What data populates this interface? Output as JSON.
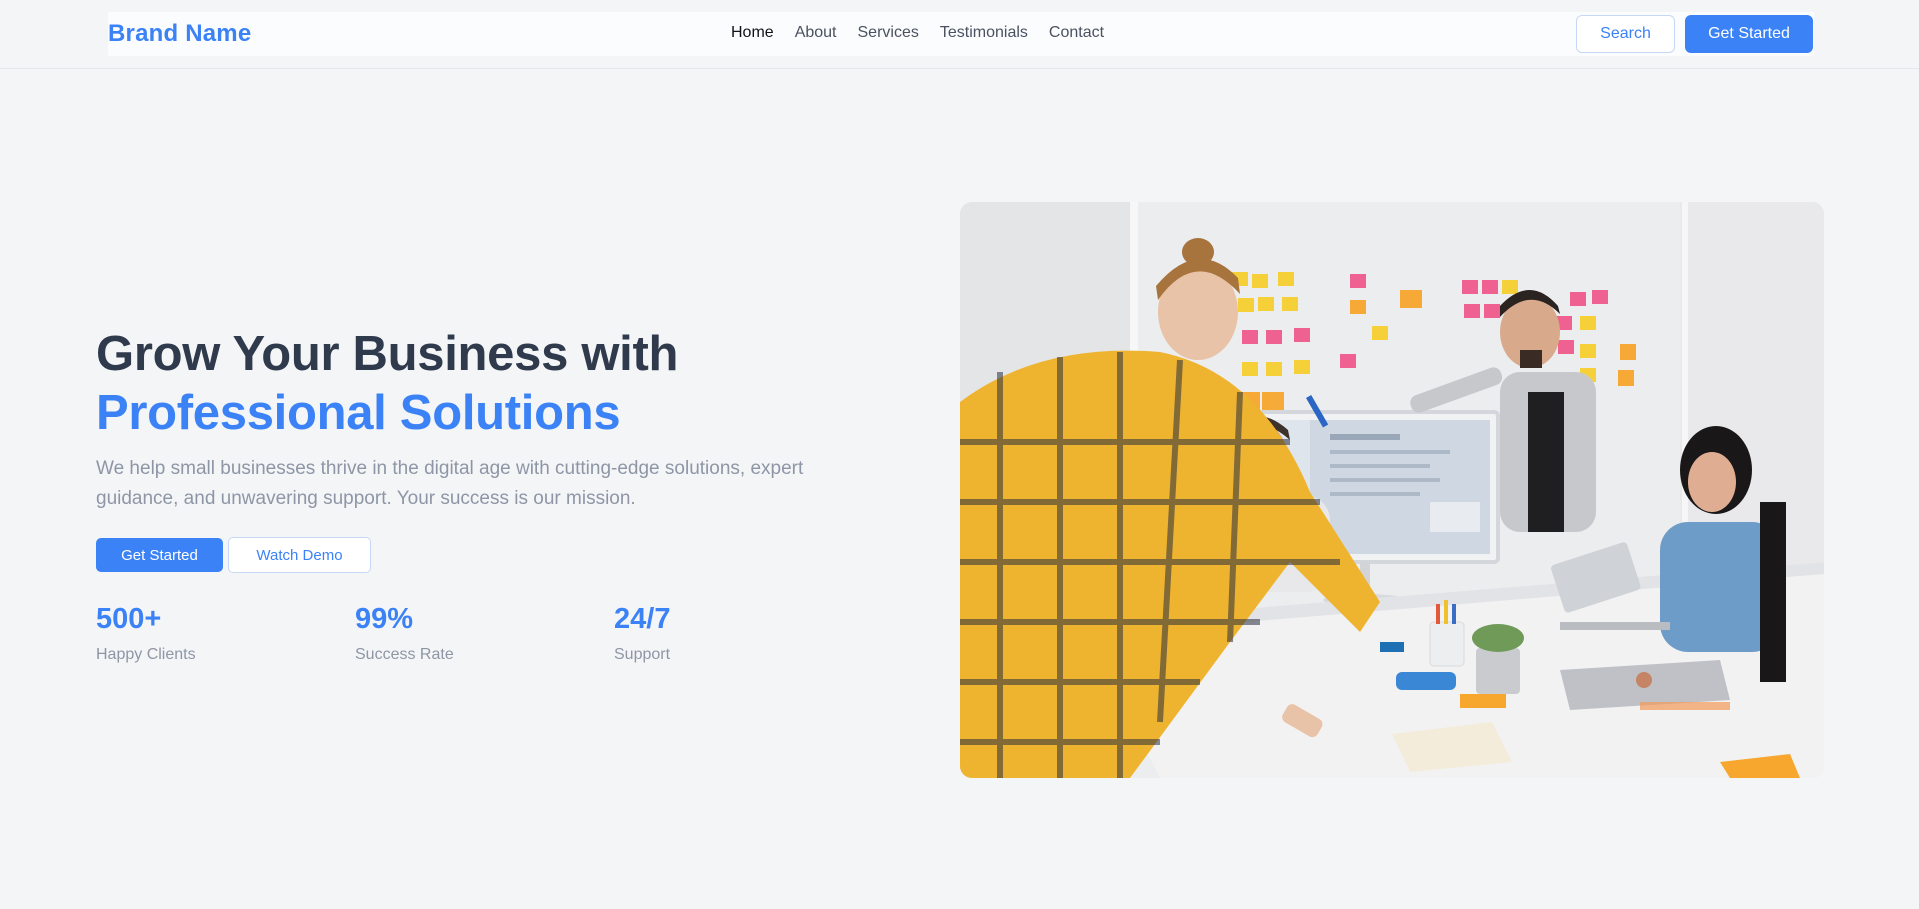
{
  "header": {
    "brand": "Brand Name",
    "nav": [
      {
        "label": "Home",
        "active": true
      },
      {
        "label": "About",
        "active": false
      },
      {
        "label": "Services",
        "active": false
      },
      {
        "label": "Testimonials",
        "active": false
      },
      {
        "label": "Contact",
        "active": false
      }
    ],
    "search_label": "Search",
    "cta_label": "Get Started"
  },
  "hero": {
    "title_line1": "Grow Your Business with",
    "title_line2": "Professional Solutions",
    "description": "We help small businesses thrive in the digital age with cutting-edge solutions, expert guidance, and unwavering support. Your success is our mission.",
    "primary_button": "Get Started",
    "secondary_button": "Watch Demo",
    "stats": [
      {
        "value": "500+",
        "label": "Happy Clients"
      },
      {
        "value": "99%",
        "label": "Success Rate"
      },
      {
        "value": "24/7",
        "label": "Support"
      }
    ],
    "image": "team-meeting-photo"
  },
  "colors": {
    "accent": "#3b82f6",
    "heading": "#2f3a4c",
    "muted": "#8e96a6",
    "background": "#f4f5f7"
  }
}
